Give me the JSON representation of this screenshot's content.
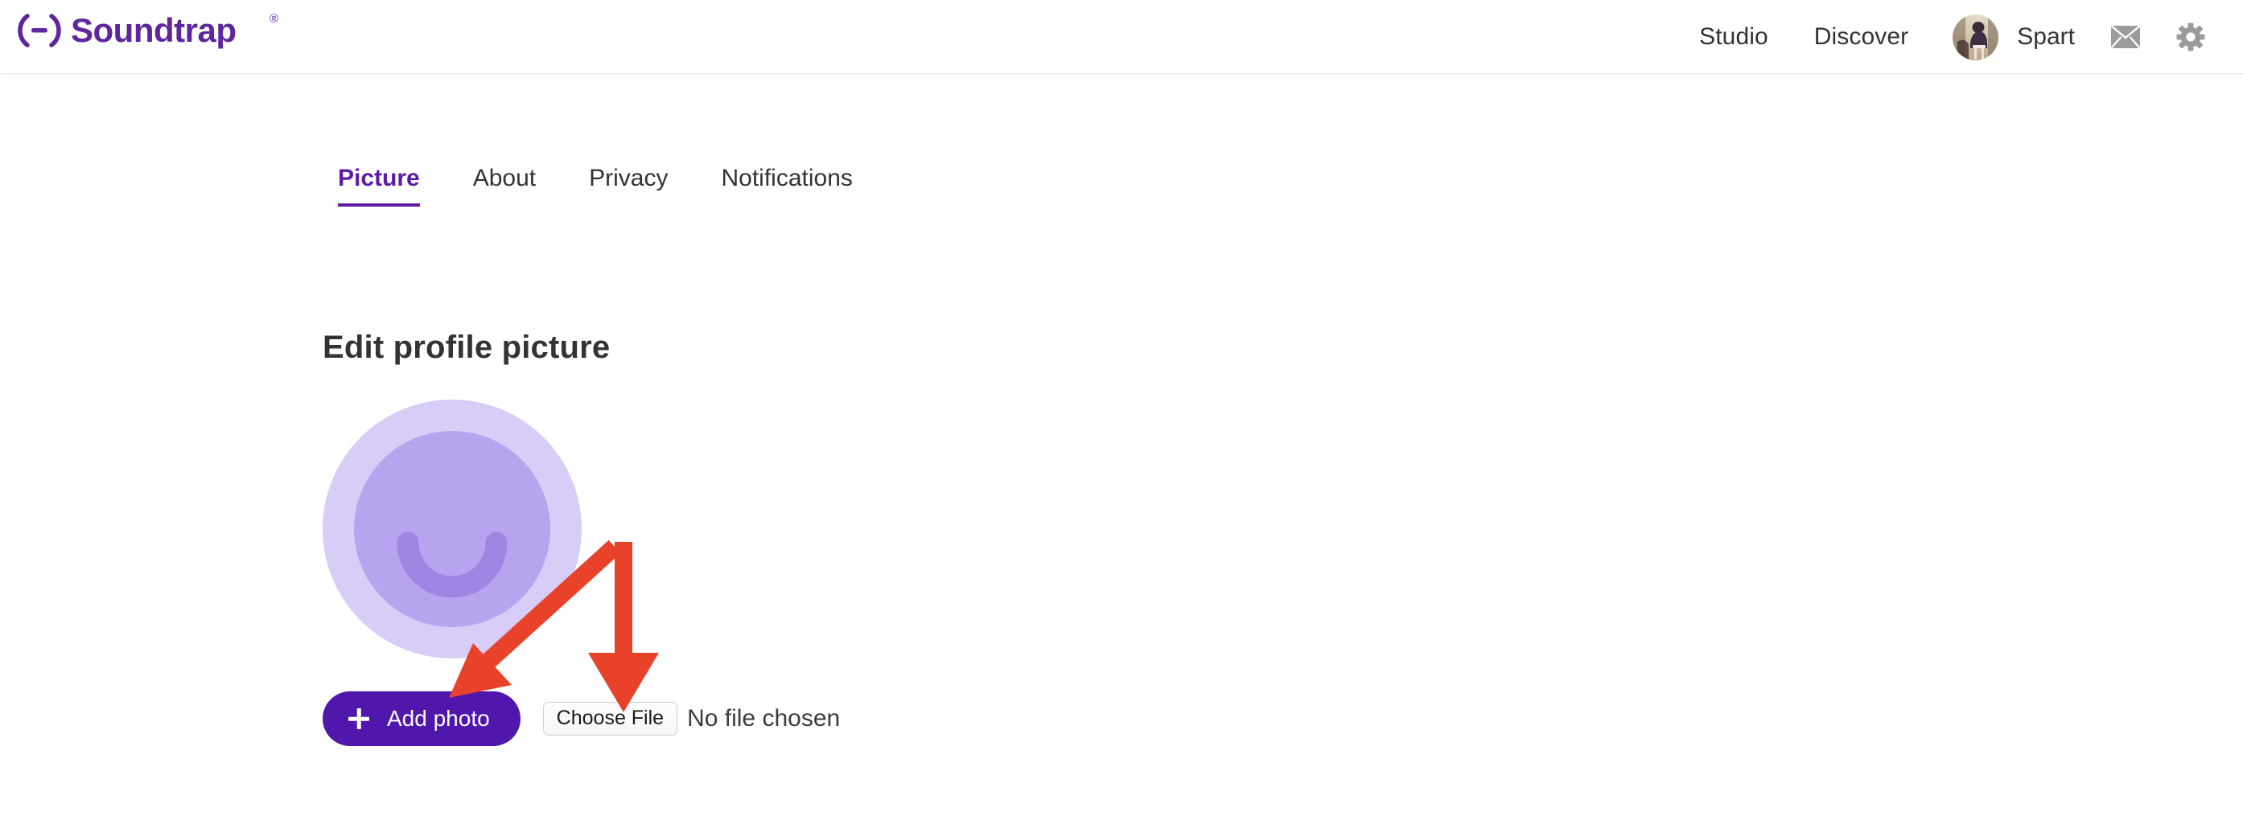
{
  "header": {
    "logo": {
      "name": "Soundtrap",
      "trademark": "®",
      "color": "#5f259f"
    },
    "nav": [
      {
        "id": "studio",
        "label": "Studio"
      },
      {
        "id": "discover",
        "label": "Discover"
      }
    ],
    "account": {
      "username": "Spart",
      "avatar_alt": "user-avatar-photo"
    },
    "icons": [
      {
        "id": "messages",
        "name": "mail-icon",
        "color": "#9b9b9b"
      },
      {
        "id": "settings",
        "name": "gear-icon",
        "color": "#9b9b9b"
      }
    ]
  },
  "tabs": {
    "active": "Picture",
    "items": [
      {
        "id": "picture",
        "label": "Picture",
        "active": true
      },
      {
        "id": "about",
        "label": "About",
        "active": false
      },
      {
        "id": "privacy",
        "label": "Privacy",
        "active": false
      },
      {
        "id": "notifications",
        "label": "Notifications",
        "active": false
      }
    ]
  },
  "main": {
    "section_title": "Edit profile picture",
    "avatar_placeholder": {
      "name": "default-smiley-avatar",
      "outer_color": "#d8cdf6",
      "inner_color": "#b7a4ef",
      "smile_color": "#9d87e2"
    },
    "add_photo_button": {
      "label": "Add photo",
      "icon": "plus-icon",
      "background": "#4f17ac",
      "text_color": "#ffffff"
    },
    "file_input": {
      "button_label": "Choose File",
      "status_text": "No file chosen"
    }
  },
  "annotations": {
    "color": "#e8432a",
    "arrows": [
      {
        "id": "arrow-to-add-photo",
        "target": "Add photo",
        "direction": "down-left"
      },
      {
        "id": "arrow-to-choose-file",
        "target": "Choose File",
        "direction": "down"
      }
    ]
  },
  "theme": {
    "brand_purple": "#5f259f",
    "accent_purple": "#4f17ac",
    "tab_active": "#5f1ba8",
    "annotation_red": "#e8432a",
    "page_background": "#ffffff",
    "text_primary": "#333333"
  }
}
